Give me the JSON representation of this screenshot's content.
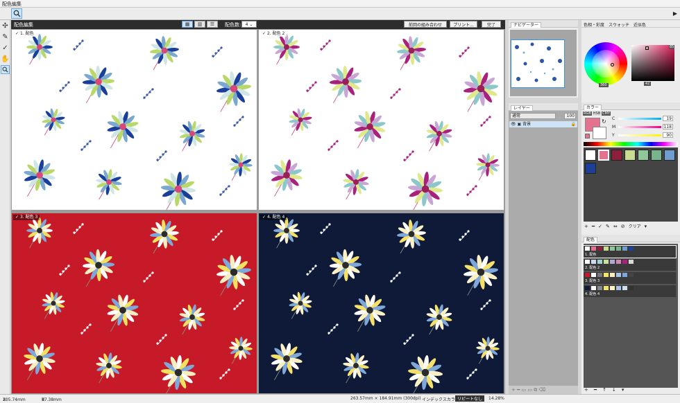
{
  "window": {
    "title": "配色編集"
  },
  "editor": {
    "header_title": "配色編集",
    "color_count_label": "配色数:",
    "color_count_value": "4",
    "buttons": {
      "previous": "前回の組み合わせ",
      "print": "プリント...",
      "done": "完了"
    },
    "panels": [
      {
        "label": "1. 配色",
        "bg": "#ffffff",
        "petals": [
          "#1a3f9a",
          "#7aa8cf",
          "#b9d86a",
          "#cfe5e6"
        ],
        "center": "#d6477a",
        "dots": "#3a57a3",
        "dark": false,
        "selected": true
      },
      {
        "label": "2. 配色 2",
        "bg": "#ffffff",
        "petals": [
          "#a8217c",
          "#c7a6d6",
          "#8cc7c9",
          "#e0e88d"
        ],
        "center": "#9a1f58",
        "dots": "#a8217c",
        "dark": false,
        "selected": false
      },
      {
        "label": "3. 配色 3",
        "bg": "#c71a28",
        "petals": [
          "#ffffff",
          "#f1e160",
          "#7fa7d9",
          "#f7eec0"
        ],
        "center": "#2b2b2b",
        "dots": "#ffffff",
        "dark": true,
        "selected": false
      },
      {
        "label": "4. 配色 4",
        "bg": "#0e1a38",
        "petals": [
          "#ffffff",
          "#f4e06a",
          "#7fa7d9",
          "#fbf1c4"
        ],
        "center": "#2b2b2b",
        "dots": "#ffffff",
        "dark": true,
        "selected": false
      }
    ]
  },
  "navigator": {
    "title": "ナビゲーター"
  },
  "layers": {
    "title": "レイヤー",
    "blend_label": "通常",
    "opacity": "100",
    "layer_name": "背景"
  },
  "right_panel": {
    "tabs": [
      "色相・彩度",
      "スウォッチ",
      "近似色"
    ],
    "hue_label": "360",
    "sv_top_value": "85",
    "sv_bottom_value": "42",
    "color_section_title": "カラー",
    "mode_tabs": [
      "RGB",
      "HSB",
      "CMY"
    ],
    "channels": [
      {
        "label": "C",
        "value": "19"
      },
      {
        "label": "M",
        "value": "118"
      },
      {
        "label": "Y",
        "value": "90"
      }
    ],
    "current_color": "#e2728e",
    "palette_colors": [
      "#ffffff",
      "#e2728e",
      "#8e1f3c",
      "#c9dc92",
      "#8fc79a",
      "#78b48c",
      "#6d9ecf",
      "#1e3f96"
    ],
    "palette_clear": "クリア",
    "scheme_section_title": "配色",
    "schemes": [
      {
        "label": "1. 配色",
        "colors": [
          "#ffffff",
          "#e2728e",
          "#8e1f3c",
          "#c9dc92",
          "#8fc79a",
          "#78b48c",
          "#6d9ecf",
          "#1e3f96"
        ]
      },
      {
        "label": "2. 配色 2",
        "colors": [
          "#ffffff",
          "#cfd9ef",
          "#9ed3d0",
          "#c6e39a",
          "#b1a8d3",
          "#d286b8",
          "#a8217c",
          "#d9d9d9"
        ]
      },
      {
        "label": "3. 配色 3",
        "colors": [
          "#c71a28",
          "#ffffff",
          "#777777",
          "#f5e46a",
          "#f7eec0",
          "#a7c3e8",
          "#7fa7d9",
          "#444444"
        ]
      },
      {
        "label": "4. 配色 4",
        "colors": [
          "#0e1a38",
          "#ffffff",
          "#888888",
          "#f5e46a",
          "#fbf1c4",
          "#a7c3e8",
          "#cfdcee",
          "#333333"
        ]
      }
    ]
  },
  "status": {
    "x_label": "X:",
    "x_value": "205.74mm",
    "y_label": "Y:",
    "y_value": "87.38mm",
    "size": "263.57mm × 184.91mm (300dpi)",
    "mode": "インデックスカラー",
    "repeat": "リピートなし",
    "zoom": "14.28%"
  }
}
